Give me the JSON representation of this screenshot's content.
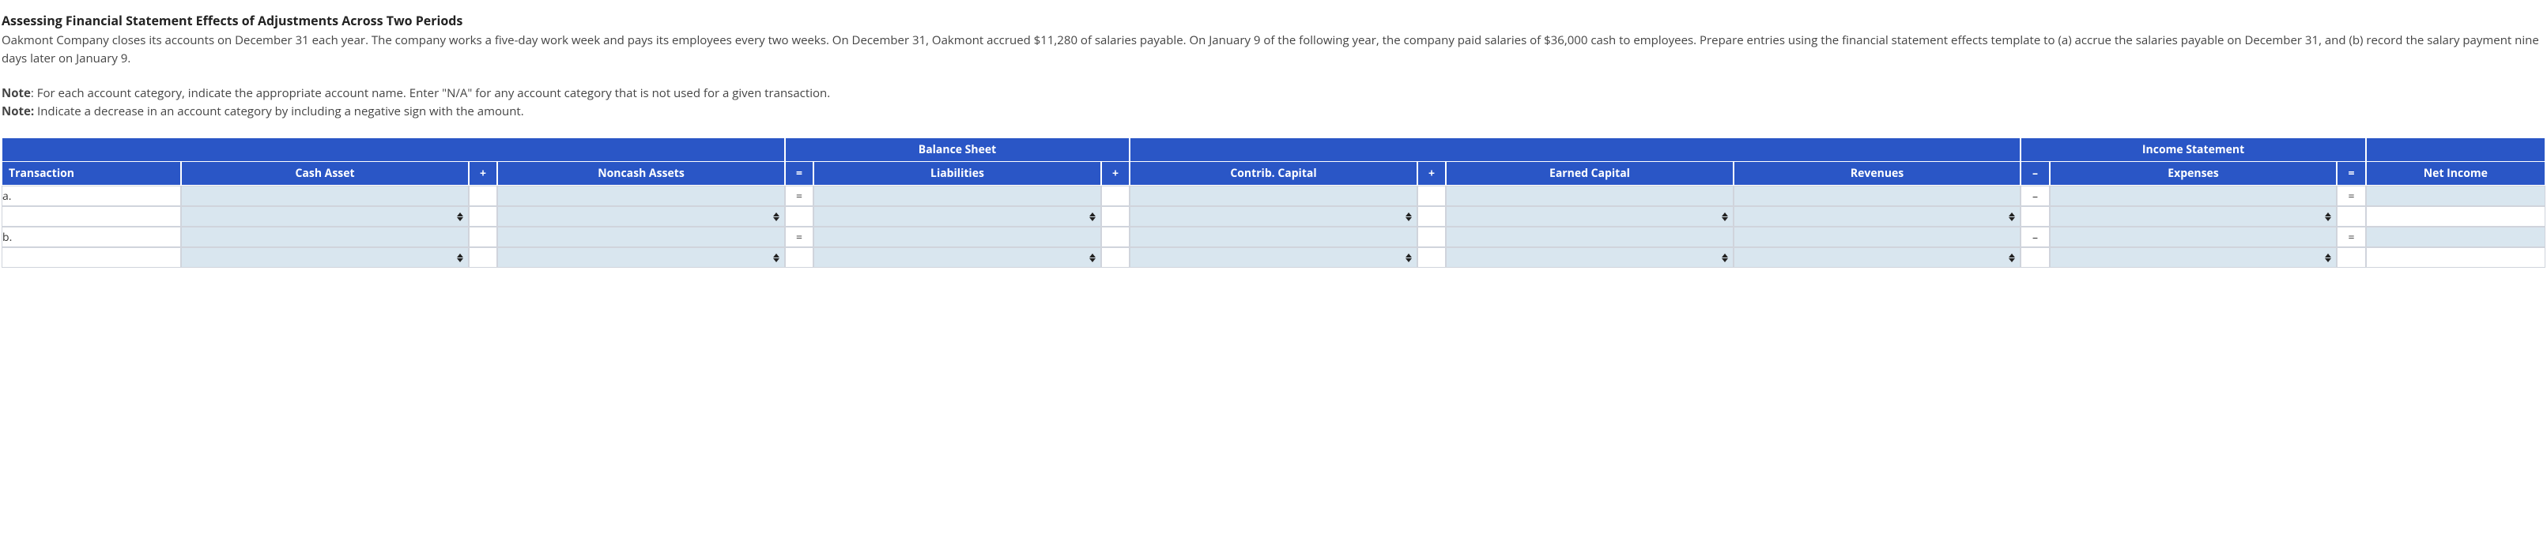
{
  "title": "Assessing Financial Statement Effects of Adjustments Across Two Periods",
  "para1": "Oakmont Company closes its accounts on December 31 each year. The company works a five-day work week and pays its employees every two weeks. On December 31, Oakmont accrued $11,280 of salaries payable. On January 9 of the following year, the company paid salaries of $36,000 cash to employees. Prepare entries using the financial statement effects template to (a) accrue the salaries payable on December 31, and (b) record the salary payment nine days later on January 9.",
  "note1_label": "Note",
  "note1_text": ": For each account category, indicate the appropriate account name. Enter \"N/A\" for any account category that is not used for a given transaction.",
  "note2_label": "Note:",
  "note2_text": " Indicate a decrease in an account category by including a negative sign with the amount.",
  "headers": {
    "group_bs": "Balance Sheet",
    "group_is": "Income Statement",
    "transaction": "Transaction",
    "cash": "Cash Asset",
    "plus1": "+",
    "noncash": "Noncash Assets",
    "eq1": "=",
    "liab": "Liabilities",
    "plus2": "+",
    "contrib": "Contrib. Capital",
    "plus3": "+",
    "earned": "Earned Capital",
    "rev": "Revenues",
    "minus": "–",
    "exp": "Expenses",
    "eq2": "=",
    "ni": "Net Income"
  },
  "rows": {
    "a_label": "a.",
    "b_label": "b.",
    "eq": "=",
    "minus": "–"
  }
}
